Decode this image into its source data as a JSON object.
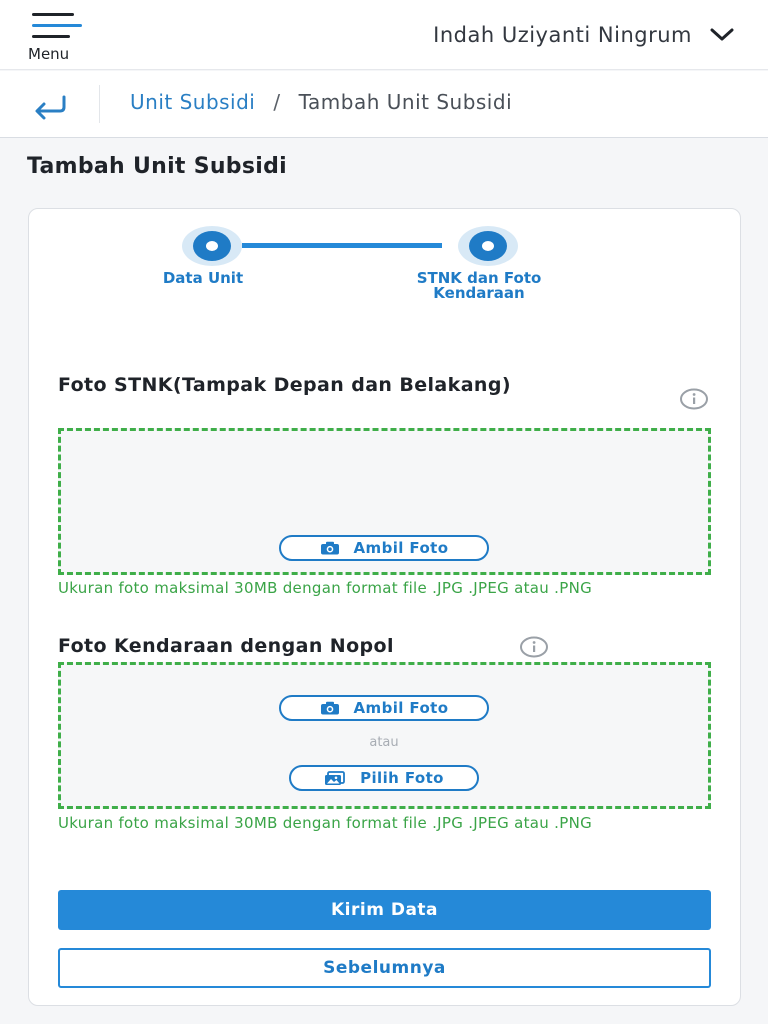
{
  "header": {
    "menu_label": "Menu",
    "user_name": "Indah Uziyanti Ningrum"
  },
  "breadcrumb": {
    "parent": "Unit Subsidi",
    "separator": "/",
    "current": "Tambah Unit Subsidi"
  },
  "page": {
    "title": "Tambah Unit Subsidi"
  },
  "stepper": {
    "steps": [
      {
        "label": "Data Unit",
        "status": "complete"
      },
      {
        "label": "STNK dan Foto Kendaraan",
        "status": "active"
      }
    ]
  },
  "form": {
    "stnk": {
      "label": "Foto STNK(Tampak Depan dan Belakang)",
      "take_photo_label": "Ambil Foto",
      "hint": "Ukuran foto maksimal 30MB dengan format file .JPG .JPEG atau .PNG"
    },
    "vehicle": {
      "label": "Foto Kendaraan dengan Nopol",
      "take_photo_label": "Ambil Foto",
      "or_label": "atau",
      "choose_photo_label": "Pilih Foto",
      "hint": "Ukuran foto maksimal 30MB dengan format file .JPG .JPEG atau .PNG"
    },
    "submit_label": "Kirim Data",
    "previous_label": "Sebelumnya"
  },
  "colors": {
    "primary": "#2589d8",
    "primary_dark": "#1f7bc6",
    "success_green": "#3aa447",
    "dropzone_border": "#3fae49"
  },
  "icons": {
    "menu": "hamburger-icon",
    "user_dropdown": "chevron-down-icon",
    "back": "back-arrow-icon",
    "info": "info-icon",
    "camera": "camera-icon",
    "gallery": "gallery-icon"
  }
}
